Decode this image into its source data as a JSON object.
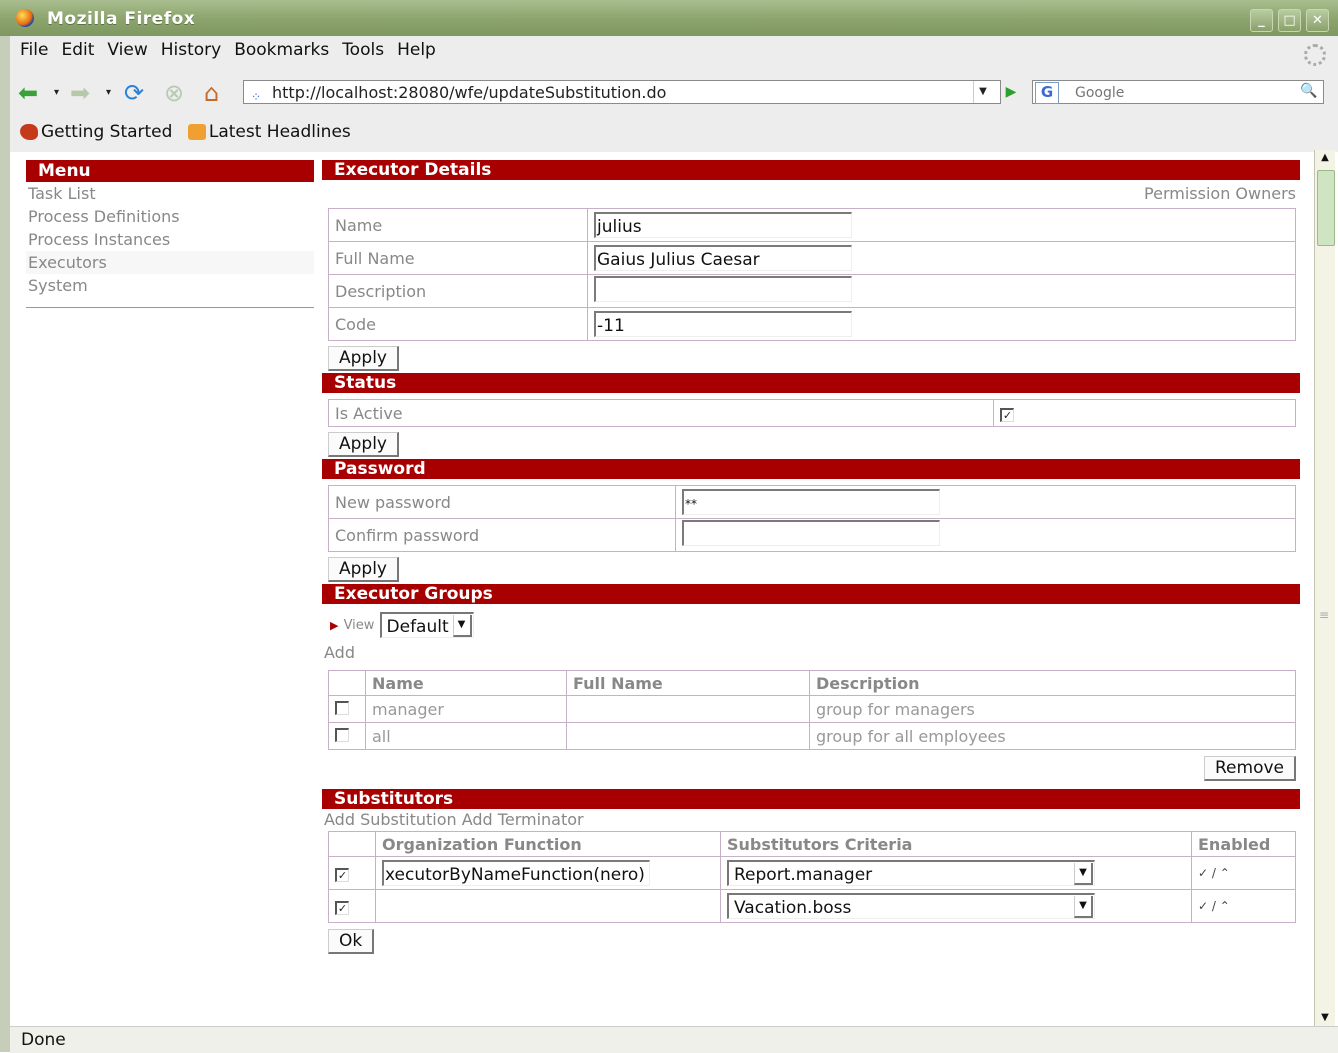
{
  "window": {
    "title": "Mozilla Firefox",
    "min": "_",
    "max": "□",
    "close": "✕"
  },
  "menu": [
    "File",
    "Edit",
    "View",
    "History",
    "Bookmarks",
    "Tools",
    "Help"
  ],
  "nav": {
    "url": "http://localhost:28080/wfe/updateSubstitution.do",
    "search_placeholder": "Google"
  },
  "bookmarks": [
    {
      "label": "Getting Started",
      "icon": "firefox-bookmark-icon"
    },
    {
      "label": "Latest Headlines",
      "icon": "rss-feed-icon"
    }
  ],
  "sidebar": {
    "title": "Menu",
    "items": [
      "Task List",
      "Process Definitions",
      "Process Instances",
      "Executors",
      "System"
    ]
  },
  "executor_details": {
    "title": "Executor Details",
    "permission_link": "Permission Owners",
    "fields": [
      {
        "label": "Name",
        "value": "julius"
      },
      {
        "label": "Full Name",
        "value": "Gaius Julius Caesar"
      },
      {
        "label": "Description",
        "value": ""
      },
      {
        "label": "Code",
        "value": "-11"
      }
    ],
    "apply": "Apply"
  },
  "status": {
    "title": "Status",
    "label": "Is Active",
    "checked": "✓",
    "apply": "Apply"
  },
  "password": {
    "title": "Password",
    "new_label": "New password",
    "new_value": "**",
    "confirm_label": "Confirm password",
    "confirm_value": "",
    "apply": "Apply"
  },
  "groups": {
    "title": "Executor Groups",
    "view_label": "View",
    "view_value": "Default",
    "add": "Add",
    "columns": [
      "Name",
      "Full Name",
      "Description"
    ],
    "rows": [
      {
        "name": "manager",
        "full": "",
        "desc": "group for managers"
      },
      {
        "name": "all",
        "full": "",
        "desc": "group for all employees"
      }
    ],
    "remove": "Remove"
  },
  "substitutors": {
    "title": "Substitutors",
    "add_sub": "Add Substitution",
    "add_term": "Add Terminator",
    "columns": [
      "Organization Function",
      "Substitutors Criteria",
      "Enabled"
    ],
    "rows": [
      {
        "function": "xecutorByNameFunction(nero)",
        "criteria": "Report.manager",
        "enabled": "✓ / ⌃"
      },
      {
        "function": "",
        "criteria": "Vacation.boss",
        "enabled": "✓ / ⌃"
      }
    ],
    "ok": "Ok"
  },
  "statusbar": "Done"
}
